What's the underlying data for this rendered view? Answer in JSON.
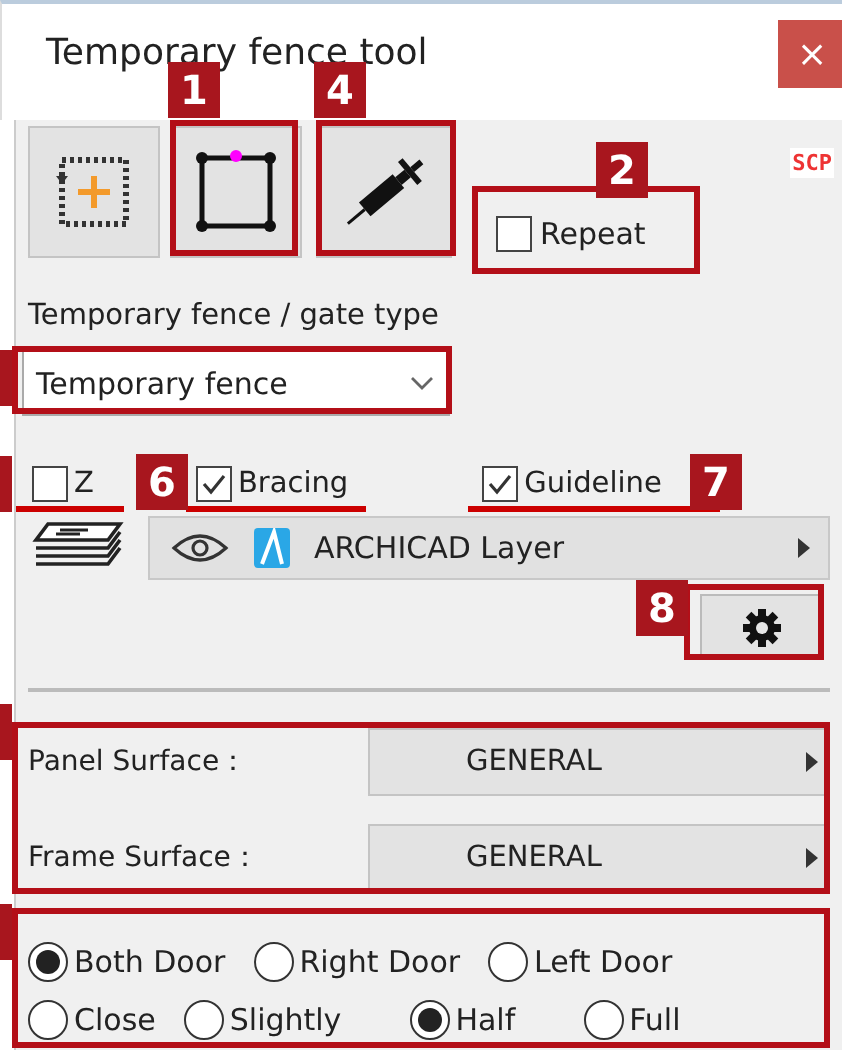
{
  "window": {
    "title": "Temporary fence tool",
    "close": "×"
  },
  "toolbar": {
    "repeat": {
      "label": "Repeat",
      "checked": false
    },
    "logo": "SCP"
  },
  "type_label": "Temporary fence / gate type",
  "type_select": {
    "value": "Temporary fence"
  },
  "options": [
    {
      "label": "Z",
      "checked": false
    },
    {
      "label": "Bracing",
      "checked": true
    },
    {
      "label": "Guideline",
      "checked": true
    }
  ],
  "layer": {
    "name": "ARCHICAD Layer"
  },
  "surfaces": [
    {
      "label": "Panel Surface：",
      "value": "GENERAL"
    },
    {
      "label": "Frame Surface：",
      "value": "GENERAL"
    }
  ],
  "radio_rows": [
    [
      {
        "label": "Both Door",
        "selected": true
      },
      {
        "label": "Right Door",
        "selected": false
      },
      {
        "label": "Left Door",
        "selected": false
      }
    ],
    [
      {
        "label": "Close",
        "selected": false
      },
      {
        "label": "Slightly",
        "selected": false
      },
      {
        "label": "Half",
        "selected": true
      },
      {
        "label": "Full",
        "selected": false
      }
    ]
  ],
  "callouts": [
    {
      "label": "1"
    },
    {
      "label": "4"
    },
    {
      "label": "2"
    },
    {
      "label": "6"
    },
    {
      "label": "7"
    },
    {
      "label": "8"
    }
  ]
}
